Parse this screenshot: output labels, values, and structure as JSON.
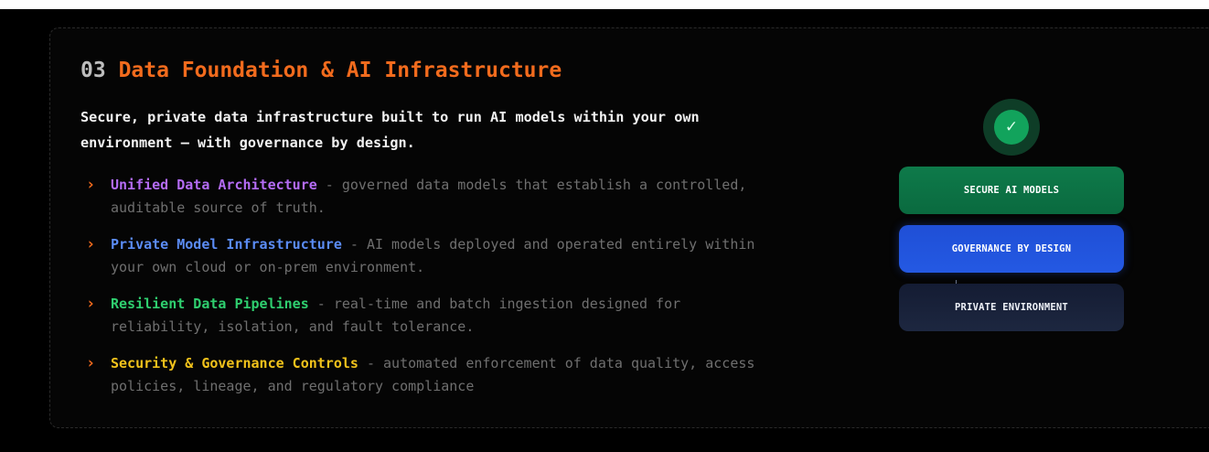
{
  "section": {
    "number": "03",
    "title": "Data Foundation & AI Infrastructure",
    "lead": "Secure, private data infrastructure built to run AI models within your own environment — with governance by design."
  },
  "features": [
    {
      "name": "Unified Data Architecture",
      "desc": " - governed data models that establish a controlled, auditable source of truth.",
      "color": "#b46cf5"
    },
    {
      "name": "Private Model Infrastructure",
      "desc": " - AI models deployed and operated entirely within your own cloud or on-prem environment.",
      "color": "#5b8cf5"
    },
    {
      "name": "Resilient Data Pipelines",
      "desc": " - real-time and batch ingestion designed for reliability, isolation, and fault tolerance.",
      "color": "#2fcf6f"
    },
    {
      "name": "Security & Governance Controls",
      "desc": " - automated enforcement of data quality, access policies, lineage, and regulatory compliance",
      "color": "#f1c21b"
    }
  ],
  "chevron": "›",
  "diagram": {
    "check_icon": "✓",
    "layers": [
      "SECURE AI MODELS",
      "GOVERNANCE BY DESIGN",
      "PRIVATE ENVIRONMENT"
    ]
  },
  "colors": {
    "accent": "#f26b1d",
    "background": "#000000",
    "secure": "#0e7a4a",
    "governance": "#2459e3",
    "private": "#1a2338"
  }
}
